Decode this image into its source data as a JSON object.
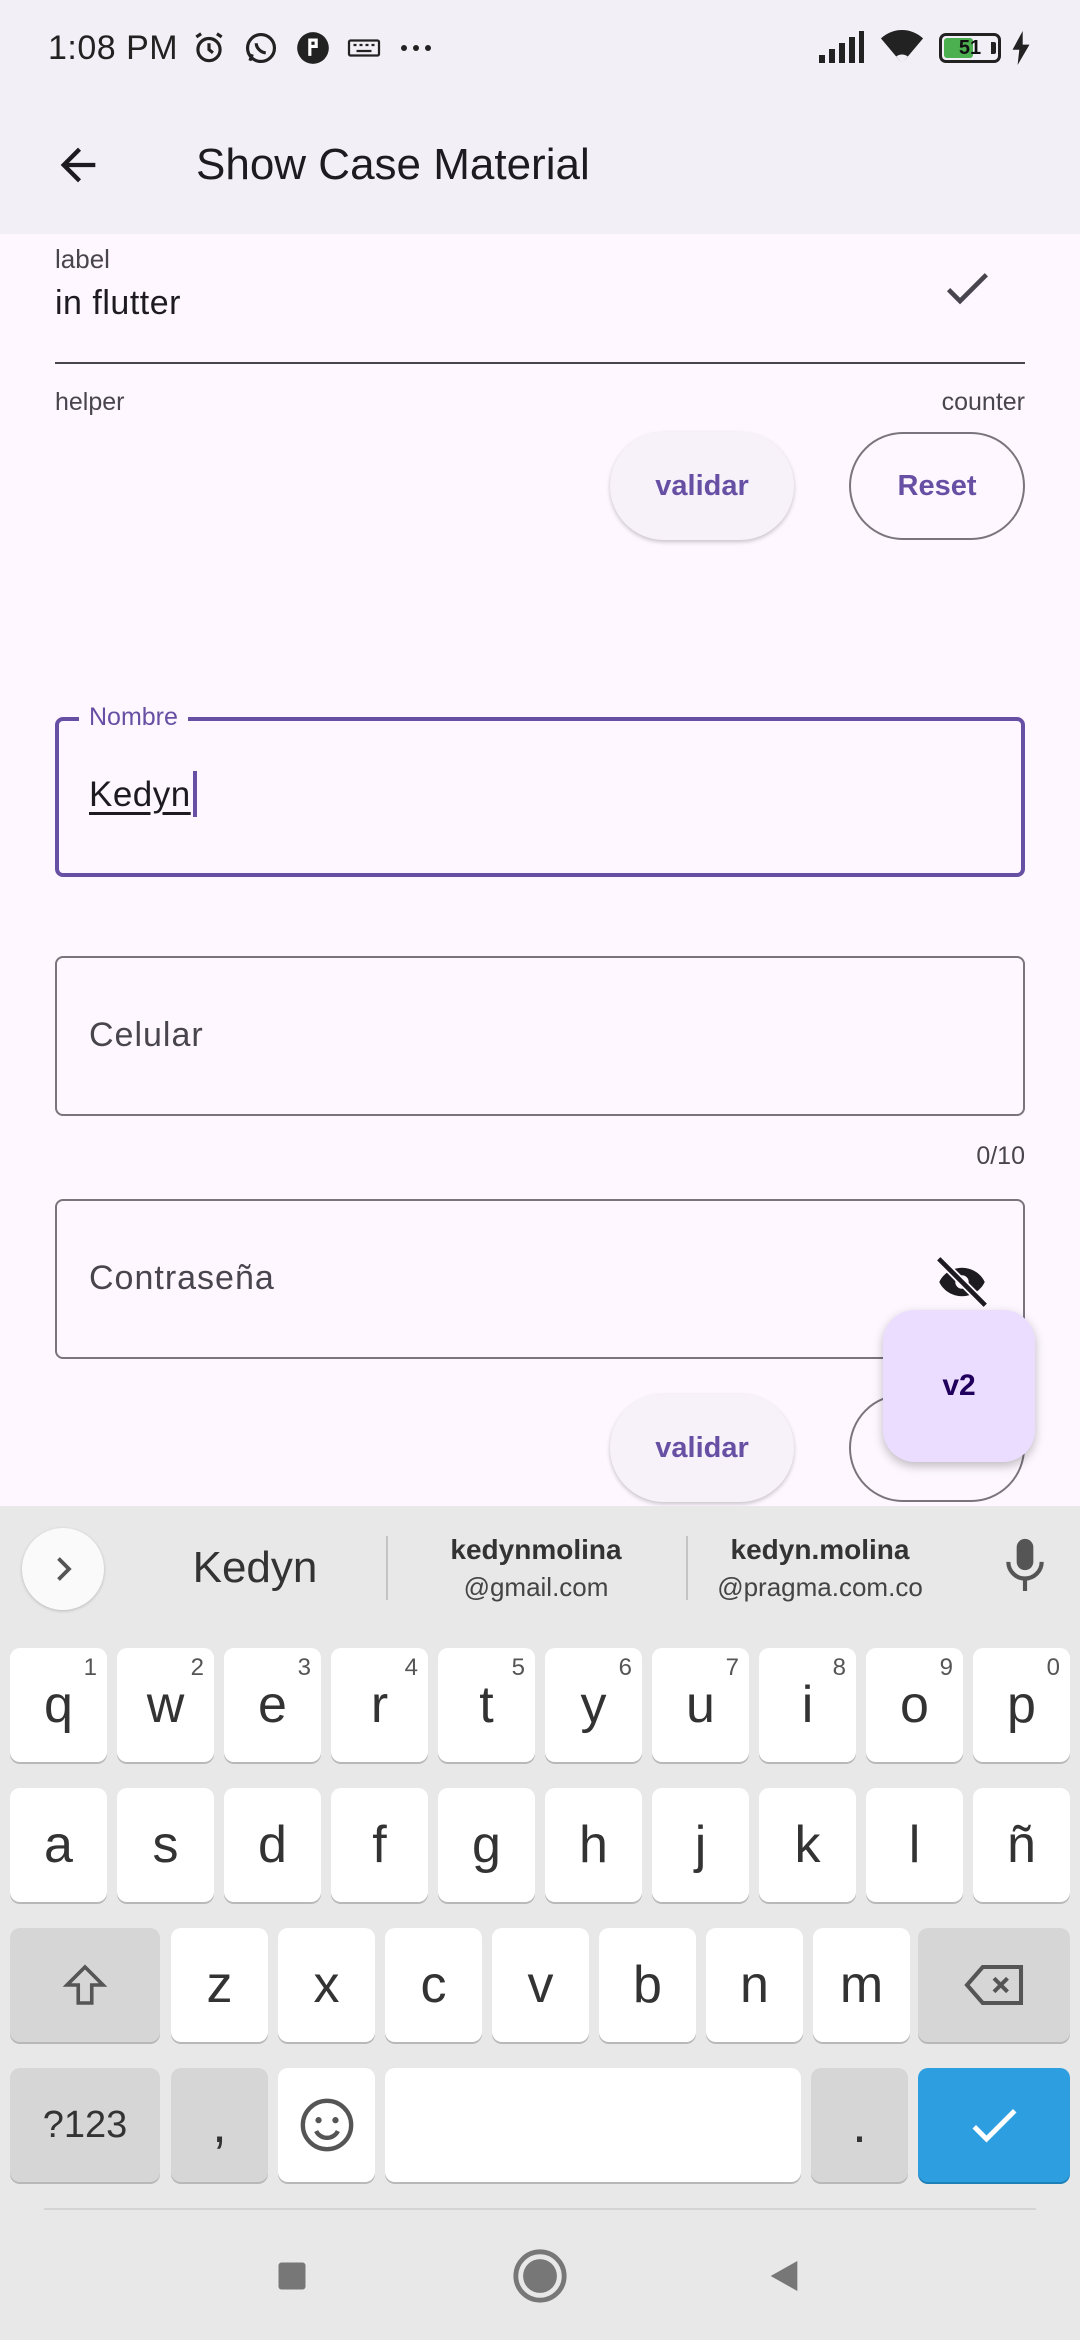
{
  "status_bar": {
    "time": "1:08 PM",
    "battery_level": "51",
    "icons_left": [
      "alarm-icon",
      "whatsapp-icon",
      "app-icon",
      "keyboard-icon",
      "more-icon"
    ],
    "icons_right": [
      "signal-icon",
      "wifi-icon",
      "battery-icon",
      "charging-icon"
    ]
  },
  "app_bar": {
    "title": "Show Case Material",
    "back_icon": "arrow-back-icon"
  },
  "form": {
    "underline_field": {
      "label": "label",
      "value": "in flutter",
      "suffix_icon": "check-icon"
    },
    "helper_text": "helper",
    "counter_text": "counter",
    "validate_label": "validar",
    "reset_label": "Reset",
    "name_field": {
      "label": "Nombre",
      "value": "Kedyn",
      "focused": true
    },
    "phone_field": {
      "placeholder": "Celular",
      "counter": "0/10"
    },
    "password_field": {
      "placeholder": "Contraseña",
      "suffix_icon": "visibility-off-icon"
    },
    "validate2_label": "validar",
    "fab_label": "v2"
  },
  "keyboard": {
    "suggestions": [
      {
        "text": "Kedyn"
      },
      {
        "line1": "kedynmolina",
        "line2": "@gmail.com"
      },
      {
        "line1": "kedyn.molina",
        "line2": "@pragma.com.co"
      }
    ],
    "row1": [
      {
        "k": "q",
        "n": "1"
      },
      {
        "k": "w",
        "n": "2"
      },
      {
        "k": "e",
        "n": "3"
      },
      {
        "k": "r",
        "n": "4"
      },
      {
        "k": "t",
        "n": "5"
      },
      {
        "k": "y",
        "n": "6"
      },
      {
        "k": "u",
        "n": "7"
      },
      {
        "k": "i",
        "n": "8"
      },
      {
        "k": "o",
        "n": "9"
      },
      {
        "k": "p",
        "n": "0"
      }
    ],
    "row2": [
      "a",
      "s",
      "d",
      "f",
      "g",
      "h",
      "j",
      "k",
      "l",
      "ñ"
    ],
    "row3": [
      "z",
      "x",
      "c",
      "v",
      "b",
      "n",
      "m"
    ],
    "row4": {
      "symbols": "?123",
      "comma": ",",
      "period": "."
    },
    "colors": {
      "enter": "#2d9ee0",
      "background": "#e8e8e8"
    }
  },
  "colors": {
    "primary": "#6750a4",
    "surface": "#fef7ff",
    "app_bar": "#f3eff6",
    "fab": "#eaddff"
  }
}
